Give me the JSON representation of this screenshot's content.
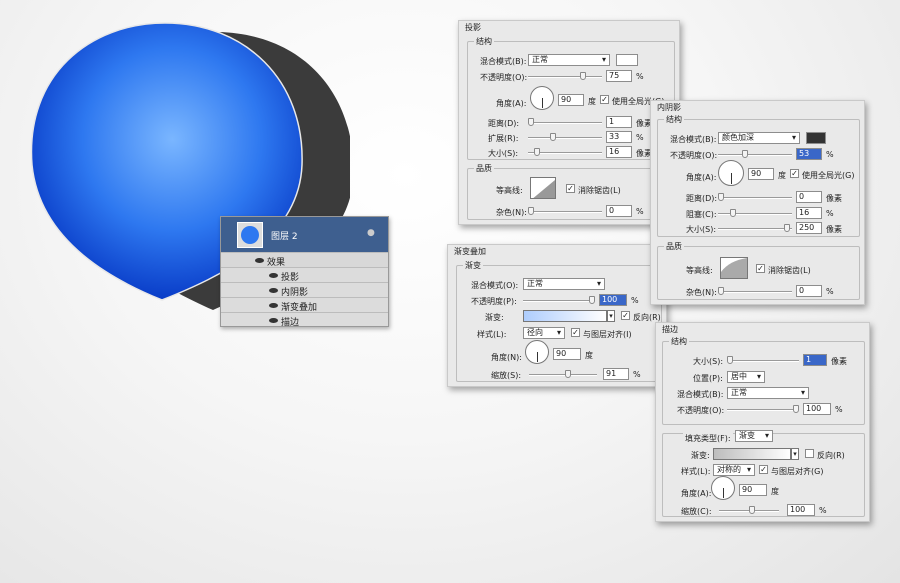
{
  "layers_panel": {
    "layer_name": "图层 2",
    "effects_label": "效果",
    "effects": [
      "投影",
      "内阴影",
      "渐变叠加",
      "描边"
    ]
  },
  "drop_shadow": {
    "title": "投影",
    "structure": "结构",
    "blend_label": "混合模式(B):",
    "blend_value": "正常",
    "opacity_label": "不透明度(O):",
    "opacity_value": "75",
    "pct": "%",
    "angle_label": "角度(A):",
    "angle_value": "90",
    "deg": "度",
    "global_light": "使用全局光(G)",
    "distance_label": "距离(D):",
    "distance_value": "1",
    "spread_label": "扩展(R):",
    "spread_value": "33",
    "size_label": "大小(S):",
    "size_value": "16",
    "px": "像素",
    "quality": "品质",
    "contour_label": "等高线:",
    "antialias": "消除锯齿(L)",
    "noise_label": "杂色(N):",
    "noise_value": "0"
  },
  "inner_shadow": {
    "title": "内阴影",
    "structure": "结构",
    "blend_label": "混合模式(B):",
    "blend_value": "颜色加深",
    "opacity_label": "不透明度(O):",
    "opacity_value": "53",
    "pct": "%",
    "angle_label": "角度(A):",
    "angle_value": "90",
    "deg": "度",
    "global_light": "使用全局光(G)",
    "distance_label": "距离(D):",
    "distance_value": "0",
    "choke_label": "阻塞(C):",
    "choke_value": "16",
    "size_label": "大小(S):",
    "size_value": "250",
    "px": "像素",
    "quality": "品质",
    "contour_label": "等高线:",
    "antialias": "消除锯齿(L)",
    "noise_label": "杂色(N):",
    "noise_value": "0",
    "swatch_color": "#333333"
  },
  "gradient_overlay": {
    "title": "渐变叠加",
    "section": "渐变",
    "blend_label": "混合模式(O):",
    "blend_value": "正常",
    "opacity_label": "不透明度(P):",
    "opacity_value": "100",
    "pct": "%",
    "gradient_label": "渐变:",
    "reverse": "反向(R)",
    "style_label": "样式(L):",
    "style_value": "径向",
    "align": "与图层对齐(I)",
    "angle_label": "角度(N):",
    "angle_value": "90",
    "deg": "度",
    "scale_label": "缩放(S):",
    "scale_value": "91"
  },
  "stroke": {
    "title": "描边",
    "structure": "结构",
    "size_label": "大小(S):",
    "size_value": "1",
    "px": "像素",
    "position_label": "位置(P):",
    "position_value": "居中",
    "blend_label": "混合模式(B):",
    "blend_value": "正常",
    "opacity_label": "不透明度(O):",
    "opacity_value": "100",
    "pct": "%",
    "fill_type_label": "填充类型(F):",
    "fill_type_value": "渐变",
    "gradient_label": "渐变:",
    "reverse": "反向(R)",
    "style_label": "样式(L):",
    "style_value": "对称的",
    "align": "与图层对齐(G)",
    "angle_label": "角度(A):",
    "angle_value": "90",
    "deg": "度",
    "scale_label": "缩放(C):",
    "scale_value": "100"
  },
  "colors": {
    "balloon_light": "#5ea0ff",
    "balloon_dark": "#0a3fd0",
    "shadow": "#3a3a3a",
    "layer_selected": "#3e5f8f"
  }
}
